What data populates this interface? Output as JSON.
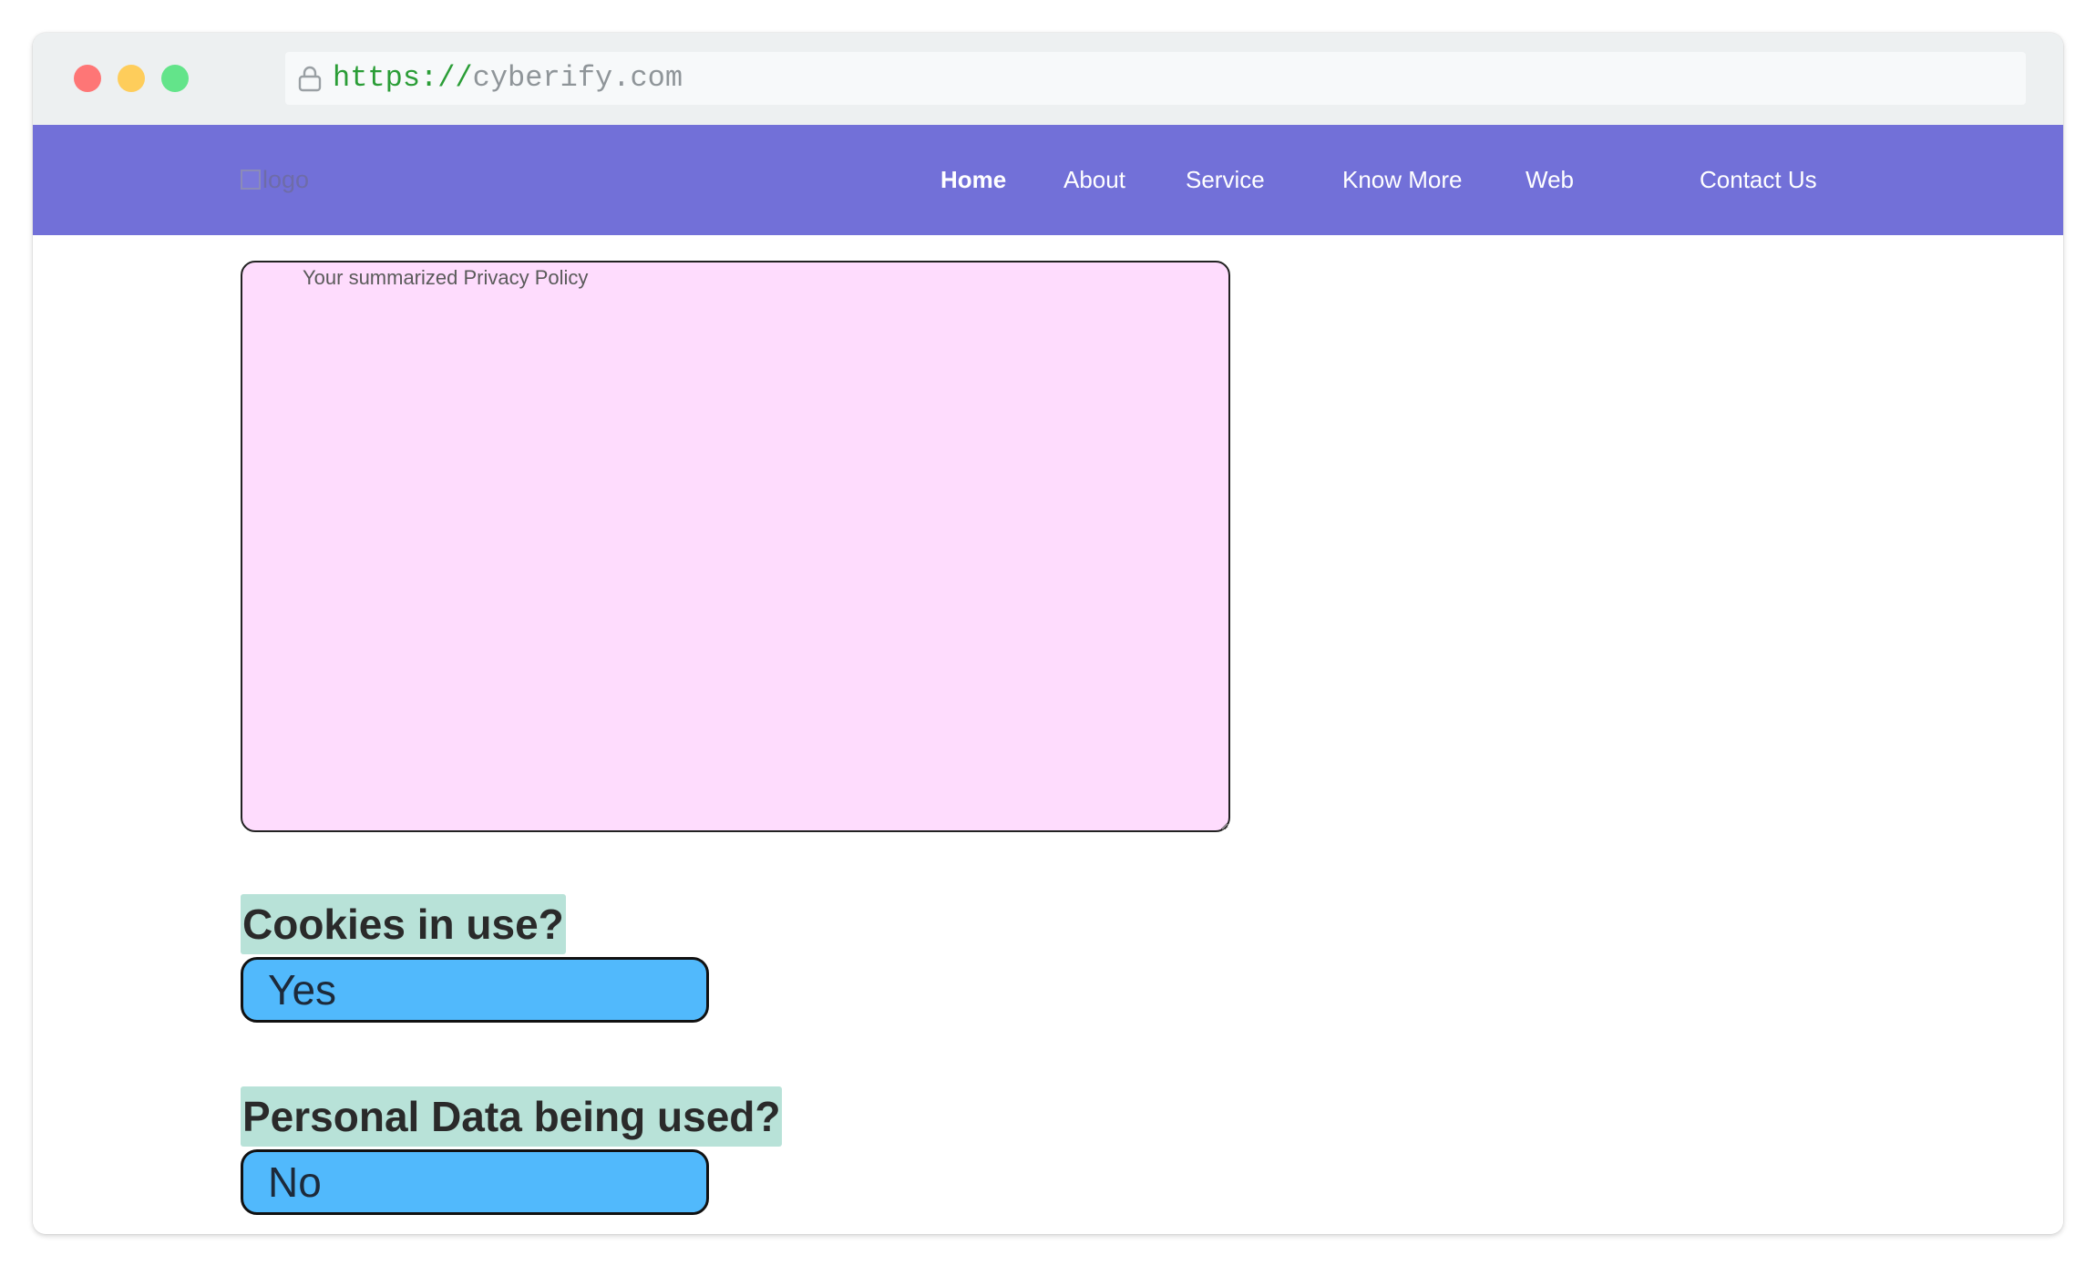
{
  "browser": {
    "url_scheme": "https://",
    "url_host": "cyberify.com"
  },
  "header": {
    "logo_text": "logo",
    "nav": [
      {
        "label": "Home",
        "active": true
      },
      {
        "label": "About",
        "active": false
      },
      {
        "label": "Service",
        "active": false
      },
      {
        "label": "Know More",
        "active": false
      },
      {
        "label": "Web",
        "active": false
      },
      {
        "label": "Contact Us",
        "active": false
      }
    ]
  },
  "main": {
    "policy_placeholder": "Your summarized Privacy Policy",
    "questions": [
      {
        "label": "Cookies in use?",
        "answer": "Yes"
      },
      {
        "label": "Personal Data being used?",
        "answer": "No"
      }
    ]
  },
  "colors": {
    "navbar": "#7270d8",
    "policy_box": "#fedcfd",
    "question_label_bg": "#b8e2d8",
    "answer_bg": "#51b9fc"
  }
}
